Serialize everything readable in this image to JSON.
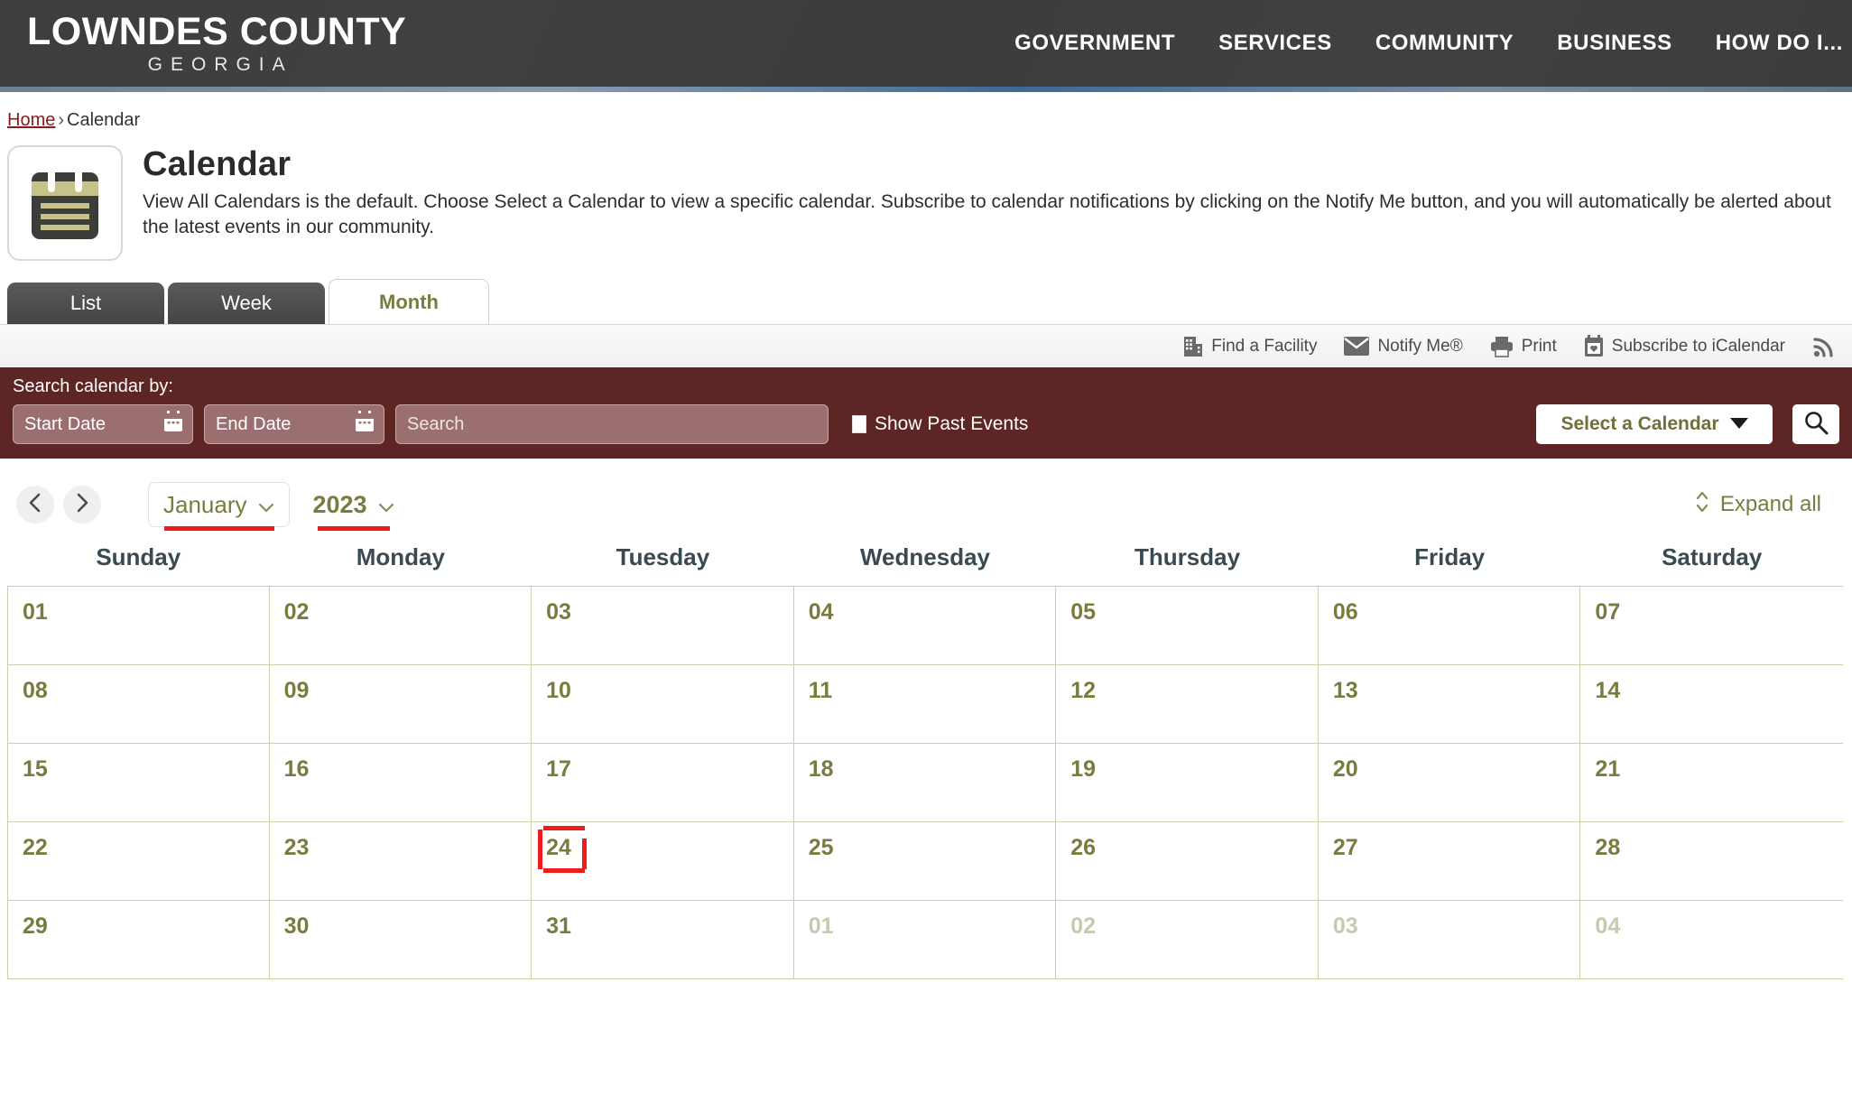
{
  "header": {
    "logo_main": "LOWNDES COUNTY",
    "logo_sub": "GEORGIA",
    "nav": [
      {
        "label": "GOVERNMENT"
      },
      {
        "label": "SERVICES"
      },
      {
        "label": "COMMUNITY"
      },
      {
        "label": "BUSINESS"
      },
      {
        "label": "HOW DO I..."
      }
    ]
  },
  "breadcrumb": {
    "home": "Home",
    "separator": "›",
    "current": "Calendar"
  },
  "page": {
    "title": "Calendar",
    "description": "View All Calendars is the default. Choose Select a Calendar to view a specific calendar. Subscribe to calendar notifications by clicking on the Notify Me button, and you will automatically be alerted about the latest events in our community.",
    "icon": "calendar-icon"
  },
  "tabs": [
    {
      "label": "List",
      "active": false
    },
    {
      "label": "Week",
      "active": false
    },
    {
      "label": "Month",
      "active": true
    }
  ],
  "toolbar": [
    {
      "label": "Find a Facility",
      "icon": "building-icon"
    },
    {
      "label": "Notify Me®",
      "icon": "envelope-icon"
    },
    {
      "label": "Print",
      "icon": "printer-icon"
    },
    {
      "label": "Subscribe to iCalendar",
      "icon": "calendar-heart-icon"
    },
    {
      "label": "",
      "icon": "rss-icon"
    }
  ],
  "search": {
    "label": "Search calendar by:",
    "start_date_placeholder": "Start Date",
    "end_date_placeholder": "End Date",
    "search_placeholder": "Search",
    "start_date_value": "",
    "end_date_value": "",
    "search_value": "",
    "show_past_events_label": "Show Past Events",
    "show_past_events_checked": false,
    "select_calendar_label": "Select a Calendar",
    "bar_color": "#5e2525"
  },
  "month_nav": {
    "prev_icon": "chevron-left-icon",
    "next_icon": "chevron-right-icon",
    "month": "January",
    "year": "2023",
    "expand_all_label": "Expand all",
    "annotation_color": "#ee1c1c"
  },
  "calendar": {
    "weekdays": [
      "Sunday",
      "Monday",
      "Tuesday",
      "Wednesday",
      "Thursday",
      "Friday",
      "Saturday"
    ],
    "highlighted_day": "24",
    "weeks": [
      [
        {
          "d": "01",
          "other": false
        },
        {
          "d": "02",
          "other": false
        },
        {
          "d": "03",
          "other": false
        },
        {
          "d": "04",
          "other": false
        },
        {
          "d": "05",
          "other": false
        },
        {
          "d": "06",
          "other": false
        },
        {
          "d": "07",
          "other": false
        }
      ],
      [
        {
          "d": "08",
          "other": false
        },
        {
          "d": "09",
          "other": false
        },
        {
          "d": "10",
          "other": false
        },
        {
          "d": "11",
          "other": false
        },
        {
          "d": "12",
          "other": false
        },
        {
          "d": "13",
          "other": false
        },
        {
          "d": "14",
          "other": false
        }
      ],
      [
        {
          "d": "15",
          "other": false
        },
        {
          "d": "16",
          "other": false
        },
        {
          "d": "17",
          "other": false
        },
        {
          "d": "18",
          "other": false
        },
        {
          "d": "19",
          "other": false
        },
        {
          "d": "20",
          "other": false
        },
        {
          "d": "21",
          "other": false
        }
      ],
      [
        {
          "d": "22",
          "other": false
        },
        {
          "d": "23",
          "other": false
        },
        {
          "d": "24",
          "other": false
        },
        {
          "d": "25",
          "other": false
        },
        {
          "d": "26",
          "other": false
        },
        {
          "d": "27",
          "other": false
        },
        {
          "d": "28",
          "other": false
        }
      ],
      [
        {
          "d": "29",
          "other": false
        },
        {
          "d": "30",
          "other": false
        },
        {
          "d": "31",
          "other": false
        },
        {
          "d": "01",
          "other": true
        },
        {
          "d": "02",
          "other": true
        },
        {
          "d": "03",
          "other": true
        },
        {
          "d": "04",
          "other": true
        }
      ]
    ]
  }
}
